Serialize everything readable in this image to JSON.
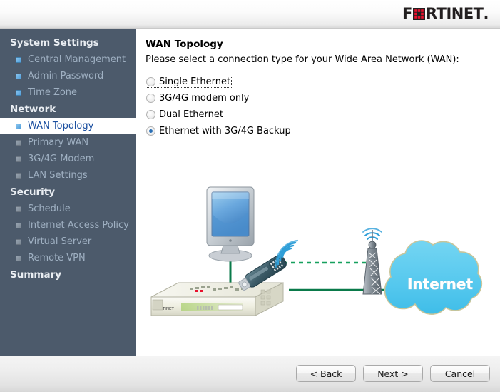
{
  "header": {
    "brand_pre": "F",
    "brand_o_icon": "fortinet-o-icon",
    "brand_post": "RTINET",
    "brand_dot": "."
  },
  "sidebar": {
    "groups": [
      {
        "title": "System Settings",
        "items": [
          {
            "label": "Central Management",
            "bullet": "blue",
            "active": false
          },
          {
            "label": "Admin Password",
            "bullet": "blue",
            "active": false
          },
          {
            "label": "Time Zone",
            "bullet": "blue",
            "active": false
          }
        ]
      },
      {
        "title": "Network",
        "items": [
          {
            "label": "WAN Topology",
            "bullet": "blue",
            "active": true
          },
          {
            "label": "Primary WAN",
            "bullet": "grey",
            "active": false
          },
          {
            "label": "3G/4G Modem",
            "bullet": "grey",
            "active": false
          },
          {
            "label": "LAN Settings",
            "bullet": "grey",
            "active": false
          }
        ]
      },
      {
        "title": "Security",
        "items": [
          {
            "label": "Schedule",
            "bullet": "grey",
            "active": false
          },
          {
            "label": "Internet Access Policy",
            "bullet": "grey",
            "active": false
          },
          {
            "label": "Virtual Server",
            "bullet": "grey",
            "active": false
          },
          {
            "label": "Remote VPN",
            "bullet": "grey",
            "active": false
          }
        ]
      },
      {
        "title": "Summary",
        "items": []
      }
    ]
  },
  "main": {
    "title": "WAN Topology",
    "subtitle": "Please select a connection type for your Wide Area Network (WAN):",
    "options": [
      {
        "label": "Single Ethernet",
        "checked": false,
        "focused": true
      },
      {
        "label": "3G/4G modem only",
        "checked": false,
        "focused": false
      },
      {
        "label": "Dual Ethernet",
        "checked": false,
        "focused": false
      },
      {
        "label": "Ethernet with 3G/4G Backup",
        "checked": true,
        "focused": false
      }
    ]
  },
  "diagram": {
    "cloud_label": "Internet",
    "nodes": [
      "monitor-icon",
      "fortigate-appliance-icon",
      "usb-3g4g-modem-icon",
      "cell-tower-icon",
      "internet-cloud-icon"
    ],
    "colors": {
      "link_solid": "#0a7a4a",
      "link_dashed": "#16a05e",
      "cloud_fill": "#5ecbee",
      "cloud_stroke": "#c9c59a",
      "modem_body": "#3d5c68",
      "wifi_arc": "#2f9fd8",
      "tower_body": "#6f7a85",
      "appliance_body": "#e9e9e0",
      "appliance_stripe": "#8fbf4a",
      "screen_blue": "#4a8fd0"
    }
  },
  "footer": {
    "buttons": [
      {
        "label": "< Back",
        "name": "back-button"
      },
      {
        "label": "Next >",
        "name": "next-button"
      },
      {
        "label": "Cancel",
        "name": "cancel-button"
      }
    ]
  }
}
